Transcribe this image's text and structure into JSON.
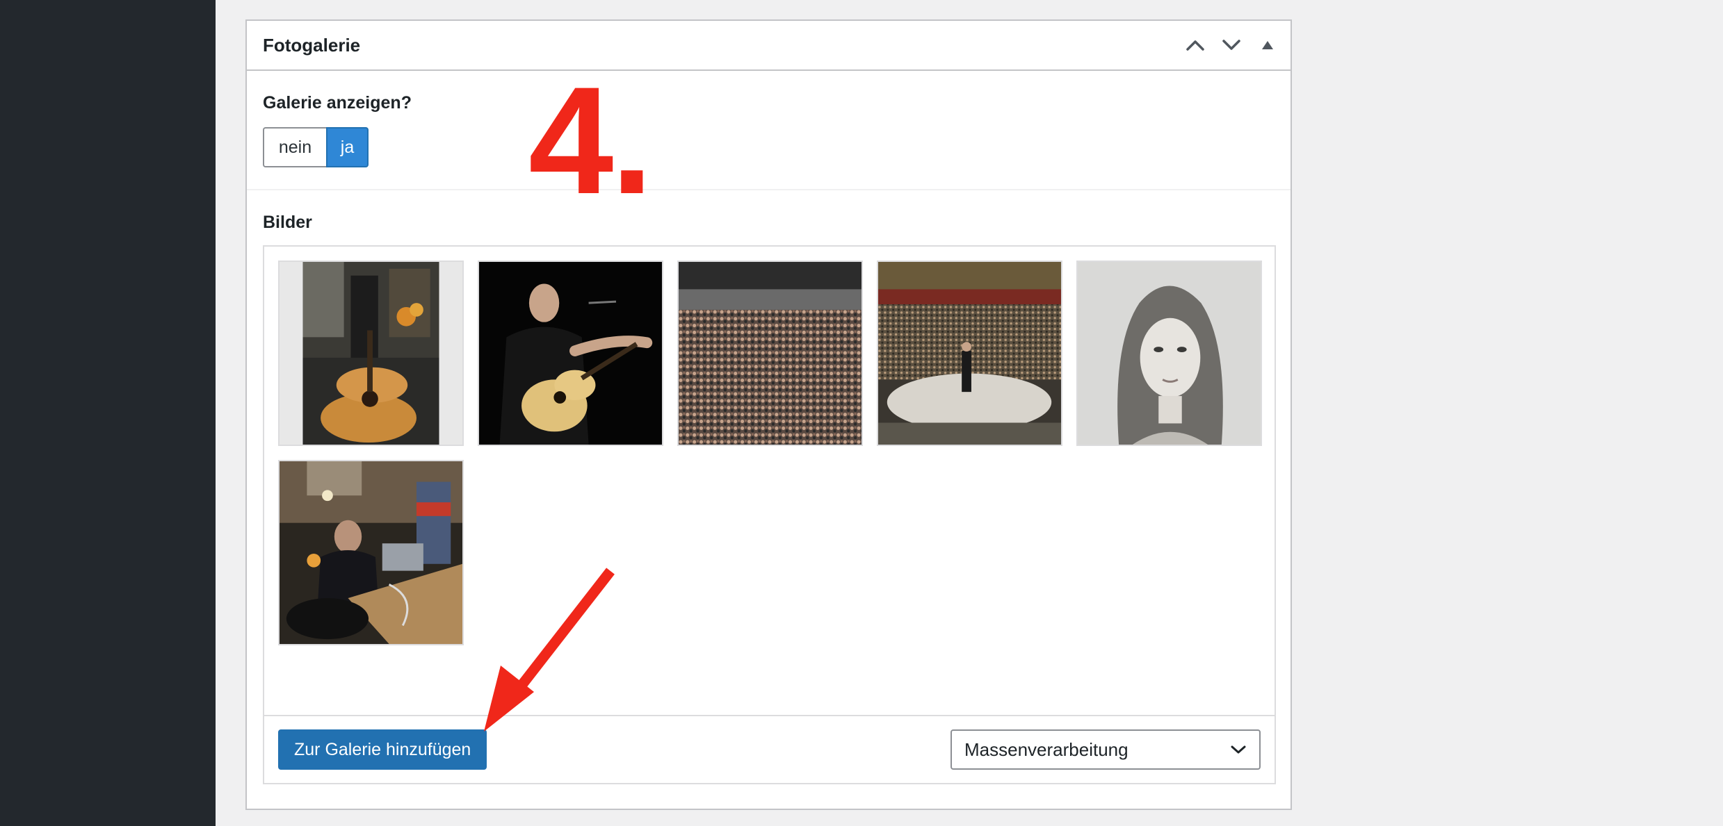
{
  "metabox": {
    "title": "Fotogalerie",
    "controls": {
      "move_up_icon": "chevron-up-icon",
      "move_down_icon": "chevron-down-icon",
      "toggle_icon": "triangle-up-icon"
    }
  },
  "show_gallery": {
    "label": "Galerie anzeigen?",
    "options": [
      "nein",
      "ja"
    ],
    "selected": "ja"
  },
  "images": {
    "label": "Bilder",
    "thumbnails": [
      {
        "subject": "acoustic guitar in living room"
      },
      {
        "subject": "guitarist performing on dark stage"
      },
      {
        "subject": "packed concert hall audience"
      },
      {
        "subject": "performer on round stage in arena"
      },
      {
        "subject": "black and white portrait of woman"
      },
      {
        "subject": "man seated at desk with equipment"
      }
    ],
    "add_button": "Zur Galerie hinzufügen",
    "bulk_select": "Massenverarbeitung"
  },
  "annotation": {
    "step": "4.",
    "color": "#f0271a"
  },
  "colors": {
    "sidebar": "#23282d",
    "primary": "#2271b1",
    "toggle_active": "#2f87d6",
    "background": "#f0f0f1"
  }
}
